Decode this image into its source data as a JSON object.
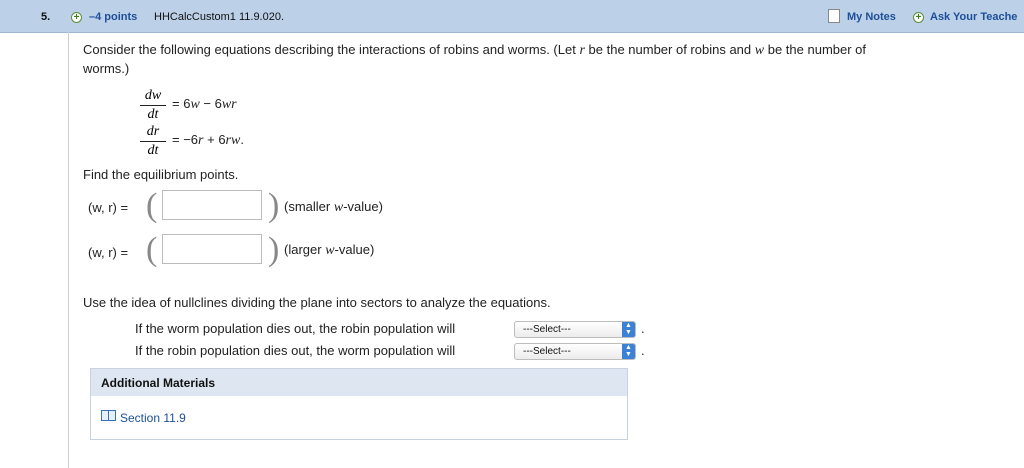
{
  "header": {
    "question_number": "5.",
    "points": "–4 points",
    "question_id": "HHCalcCustom1 11.9.020.",
    "my_notes": "My Notes",
    "ask_teacher": "Ask Your Teache"
  },
  "problem": {
    "intro_1": "Consider the following equations describing the interactions of robins and worms. (Let",
    "var_r": "r",
    "intro_2": "be the number of robins and",
    "var_w": "w",
    "intro_3": "be the number of",
    "intro_4": "worms.)",
    "eq1_num": "dw",
    "eq1_den": "dt",
    "eq1_rhs_a": "= 6",
    "eq1_rhs_b": "w",
    "eq1_rhs_c": "− 6",
    "eq1_rhs_d": "wr",
    "eq2_num": "dr",
    "eq2_den": "dt",
    "eq2_rhs_a": "= −6",
    "eq2_rhs_b": "r",
    "eq2_rhs_c": "+ 6",
    "eq2_rhs_d": "rw",
    "eq2_rhs_e": ".",
    "find_label": "Find the equilibrium points.",
    "pair_label": "(w, r) =",
    "open_paren": "(",
    "close_paren": ")",
    "hint1_a": "(smaller",
    "hint1_b": "w",
    "hint1_c": "-value)",
    "hint2_a": "(larger",
    "hint2_b": "w",
    "hint2_c": "-value)",
    "answer1_value": "",
    "answer2_value": "",
    "nullcline_text": "Use the idea of nullclines dividing the plane into sectors to analyze the equations.",
    "worm_statement": "If the worm population dies out, the robin population will",
    "robin_statement": "If the robin population dies out, the worm population will",
    "select1_value": "---Select---",
    "select2_value": "---Select---",
    "period": "."
  },
  "additional": {
    "title": "Additional Materials",
    "section_link": "Section 11.9"
  },
  "colors": {
    "header_bg": "#bcd0e8",
    "link_blue": "#1d4f98",
    "select_arrow": "#3b82d6"
  }
}
